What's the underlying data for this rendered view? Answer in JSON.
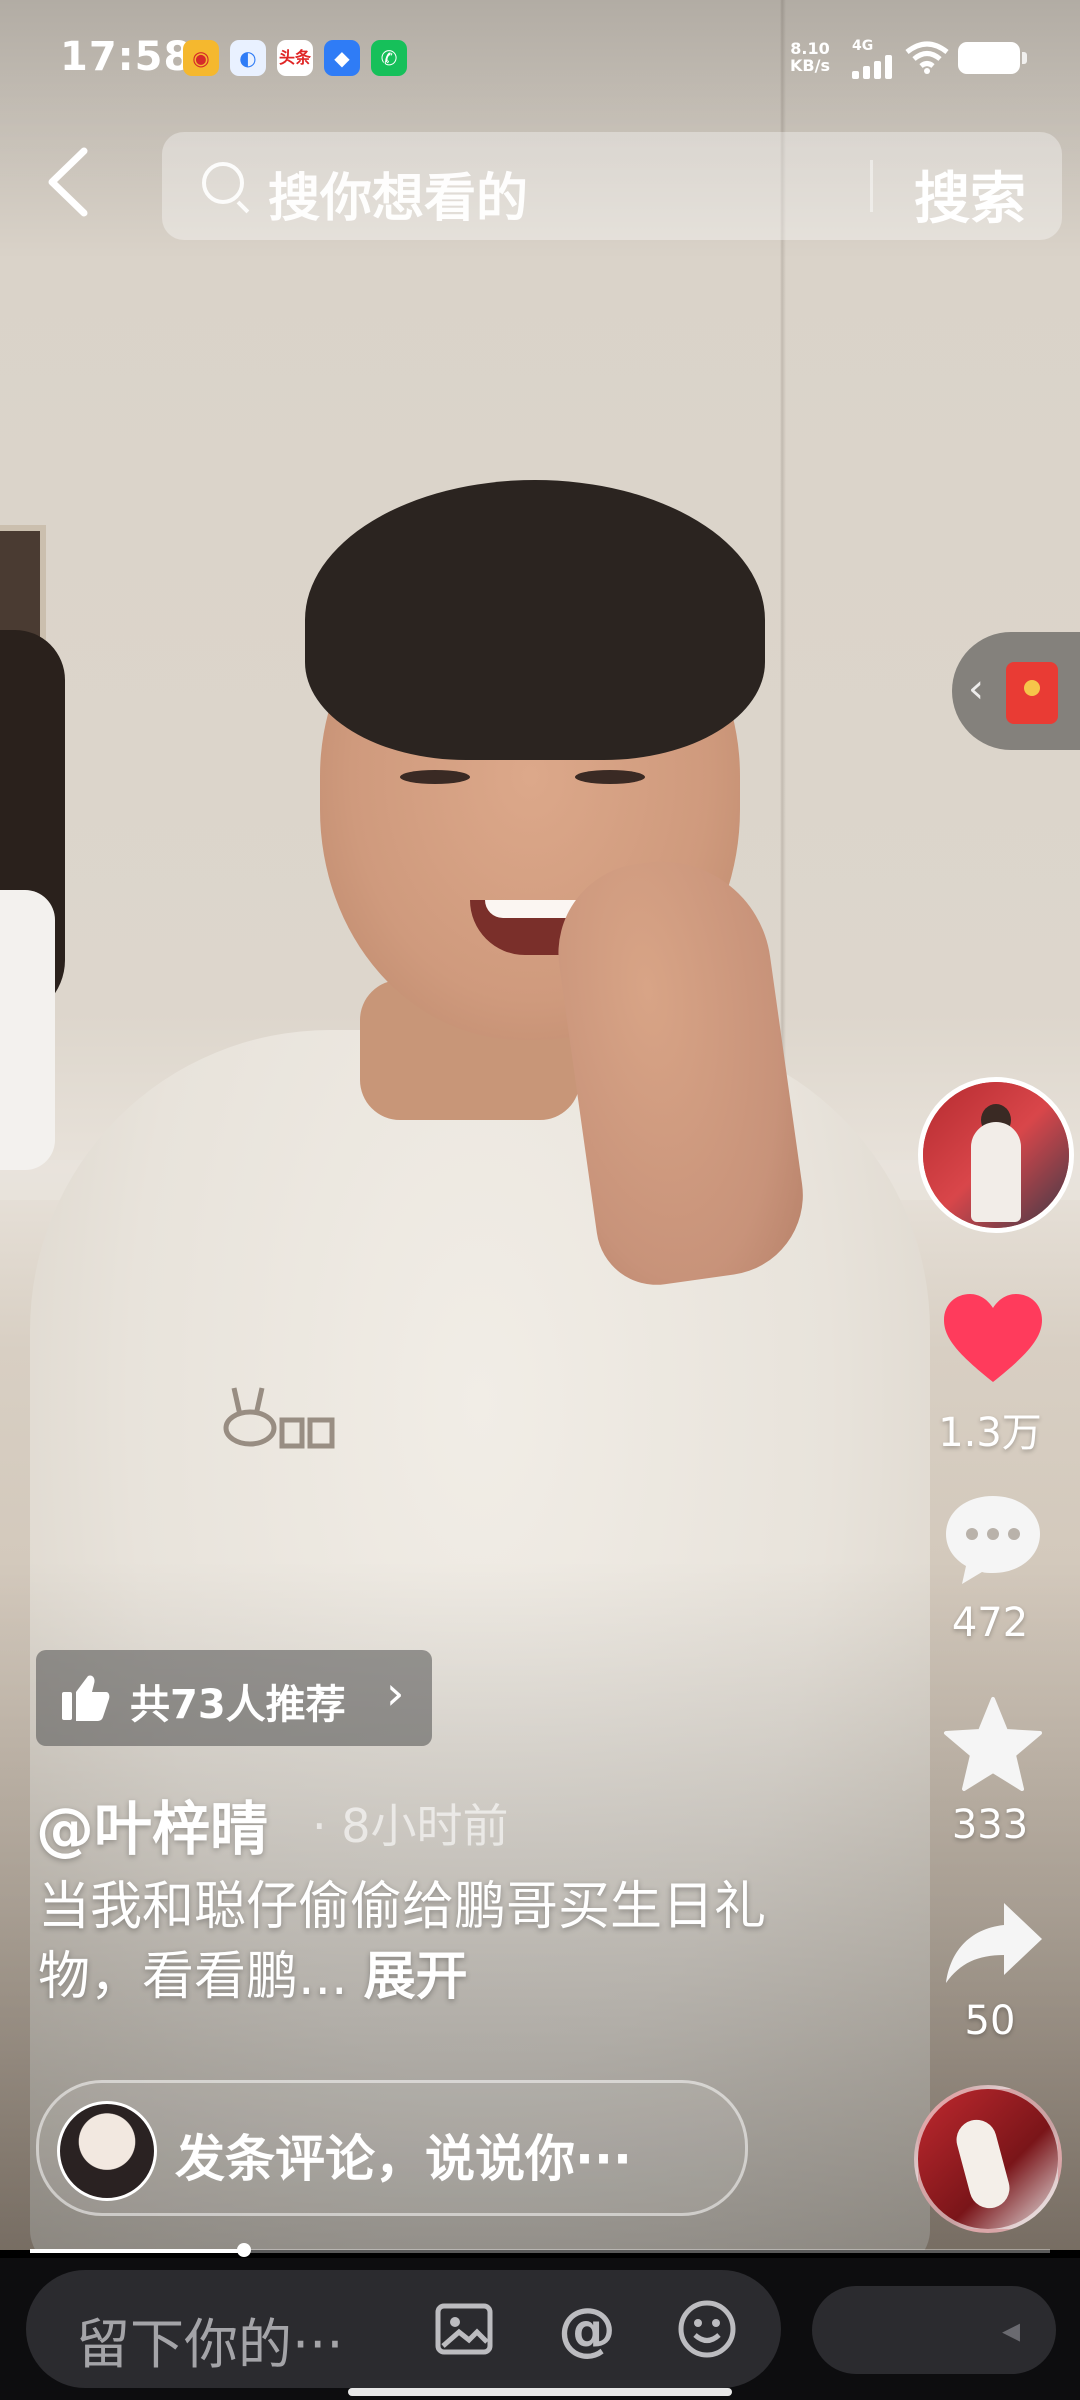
{
  "status_bar": {
    "time": "17:58",
    "net_speed_value": "8.10",
    "net_speed_unit": "KB/s",
    "network_type": "4G",
    "notification_icons": [
      "weibo-icon",
      "mi-browser-icon",
      "toutiao-icon",
      "feather-icon",
      "phone-icon"
    ],
    "toutiao_label": "头条"
  },
  "search": {
    "placeholder": "搜你想看的",
    "button_label": "搜索"
  },
  "actions": {
    "likes": "1.3万",
    "comments": "472",
    "favorites": "333",
    "shares": "50"
  },
  "recommend": {
    "label": "共73人推荐"
  },
  "post": {
    "author": "@叶梓晴",
    "time_ago": "· 8小时前",
    "caption": "当我和聪仔偷偷给鹏哥买生日礼物，看看鹏...",
    "expand_label": "展开"
  },
  "comment_prompt": "发条评论，说说你···",
  "playback": {
    "progress_fraction": 0.21
  },
  "bottom_input": {
    "placeholder": "留下你的···"
  },
  "colors": {
    "like_red": "#ff3b5c",
    "bottom_bar": "#0d0d0f",
    "pill": "#2b2b2f"
  }
}
